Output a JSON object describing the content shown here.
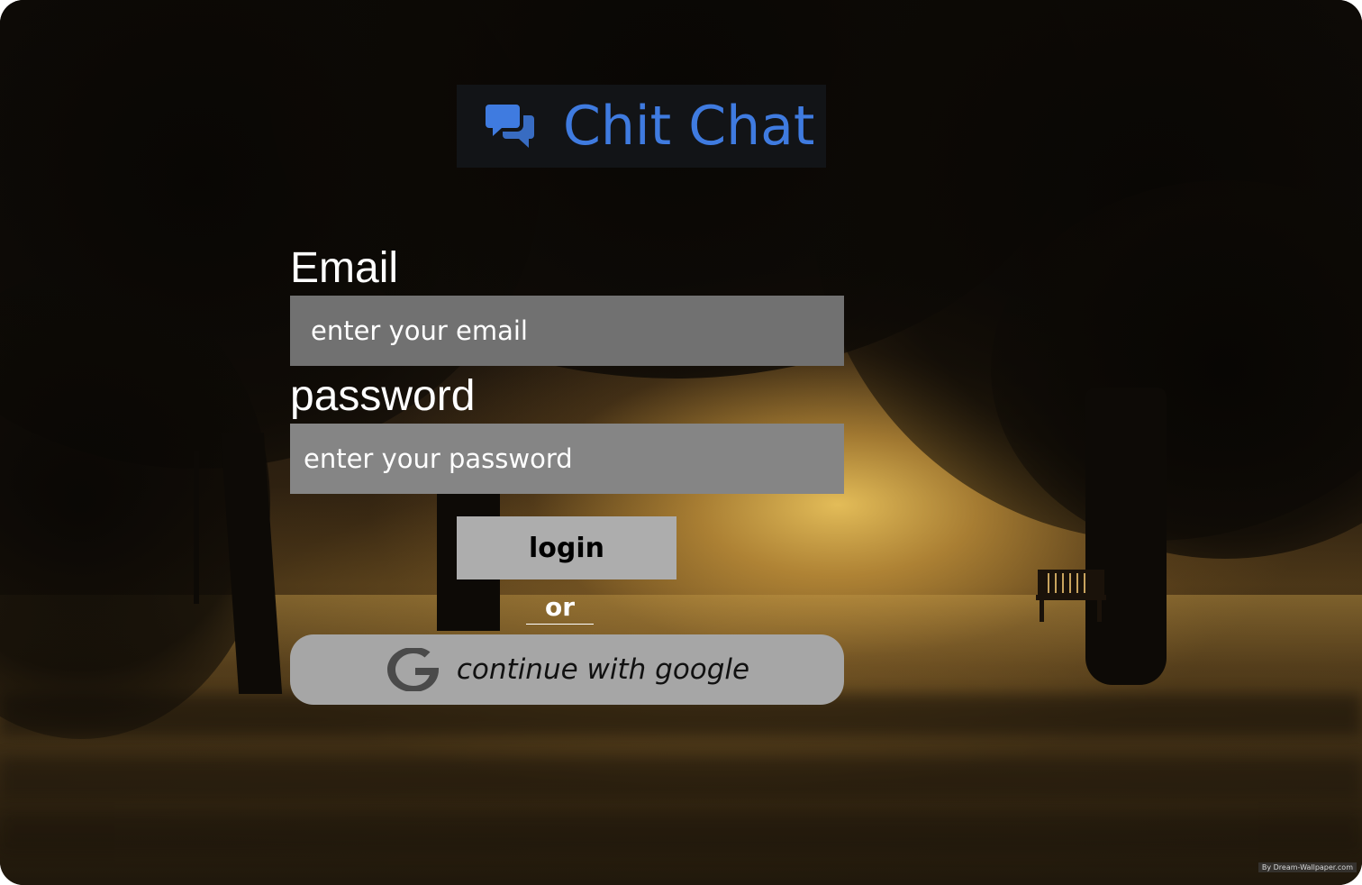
{
  "app": {
    "logo_text": "Chit Chat",
    "logo_icon": "chat-bubbles-icon",
    "brand_color": "#3f7be0"
  },
  "form": {
    "email_label": "Email",
    "email_placeholder": "enter your email",
    "password_label": "password",
    "password_placeholder": "enter your password",
    "login_label": "login",
    "divider_text": "or",
    "google_label": "continue with google",
    "google_icon": "google-g-icon"
  },
  "background": {
    "watermark": "By Dream-Wallpaper.com"
  }
}
